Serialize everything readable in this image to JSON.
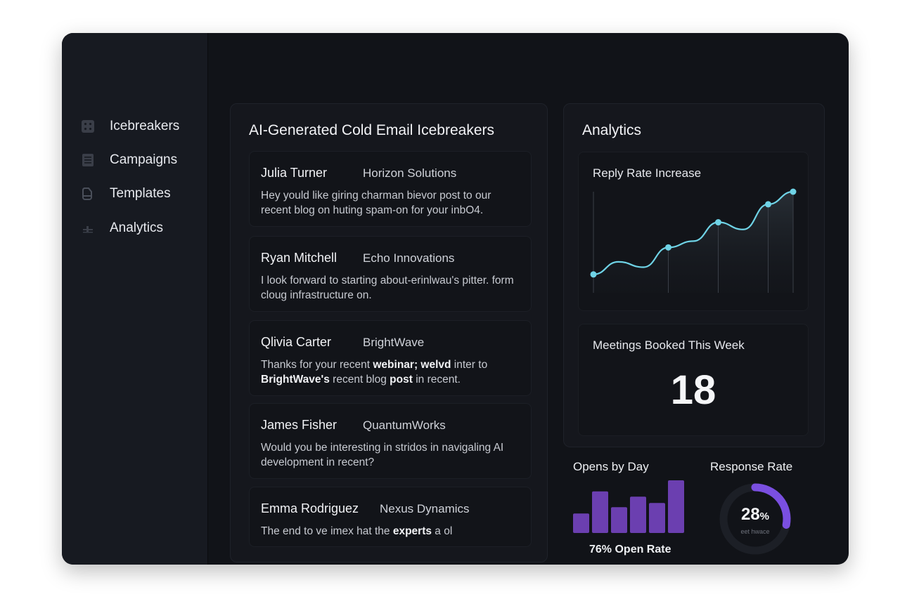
{
  "sidebar": {
    "items": [
      {
        "label": "Icebreakers",
        "icon": "grid-icon"
      },
      {
        "label": "Campaigns",
        "icon": "list-icon"
      },
      {
        "label": "Templates",
        "icon": "template-icon"
      },
      {
        "label": "Analytics",
        "icon": "bar-chart-icon"
      }
    ]
  },
  "icebreakers": {
    "title": "AI-Generated Cold Email Icebreakers",
    "items": [
      {
        "name": "Julia Turner",
        "company": "Horizon Solutions",
        "message_html": "Hey yould like giring charman bievor post to our recent blog on huting spam-on for your inbO4."
      },
      {
        "name": "Ryan Mitchell",
        "company": "Echo Innovations",
        "message_html": "I look forward to starting about-erinlwau's pitter. form cloug infrastructure on."
      },
      {
        "name": "Qlivia Carter",
        "company": "BrightWave",
        "message_html": "Thanks for your recent <b>webinar; welvd</b> inter to <b>BrightWave's</b> recent blog <b>post</b> in recent."
      },
      {
        "name": "James Fisher",
        "company": "QuantumWorks",
        "message_html": "Would you be interesting in stridos in navigaling AI development in recent?"
      },
      {
        "name": "Emma Rodriguez",
        "company": "Nexus Dynamics",
        "message_html": "The end to ve imex hat the <b>experts</b> a ol"
      }
    ]
  },
  "analytics": {
    "title": "Analytics",
    "reply_rate": {
      "title": "Reply Rate Increase"
    },
    "meetings": {
      "title": "Meetings Booked This Week",
      "value": "18"
    },
    "opens_by_day": {
      "title": "Opens by Day",
      "caption": "76% Open Rate"
    },
    "response_rate": {
      "title": "Response Rate",
      "value": "28",
      "unit": "%",
      "sub": "eet hwace",
      "fraction": 0.28
    }
  },
  "colors": {
    "accent_cyan": "#6fd3e6",
    "accent_purple": "#6b3fb0",
    "ring_purple": "#7a4fe0"
  },
  "chart_data": [
    {
      "type": "line",
      "title": "Reply Rate Increase",
      "x": [
        0,
        1,
        2,
        3,
        4,
        5,
        6,
        7,
        8
      ],
      "y": [
        0.08,
        0.22,
        0.16,
        0.38,
        0.45,
        0.66,
        0.58,
        0.86,
        1.0
      ],
      "markers_at": [
        0,
        3,
        5,
        7,
        8
      ],
      "ylim": [
        0,
        1
      ],
      "xlabel": "",
      "ylabel": ""
    },
    {
      "type": "bar",
      "title": "Opens by Day",
      "categories": [
        "",
        "",
        "",
        "",
        "",
        ""
      ],
      "values": [
        0.37,
        0.79,
        0.49,
        0.69,
        0.57,
        1.0
      ],
      "ylim": [
        0,
        1
      ]
    }
  ]
}
